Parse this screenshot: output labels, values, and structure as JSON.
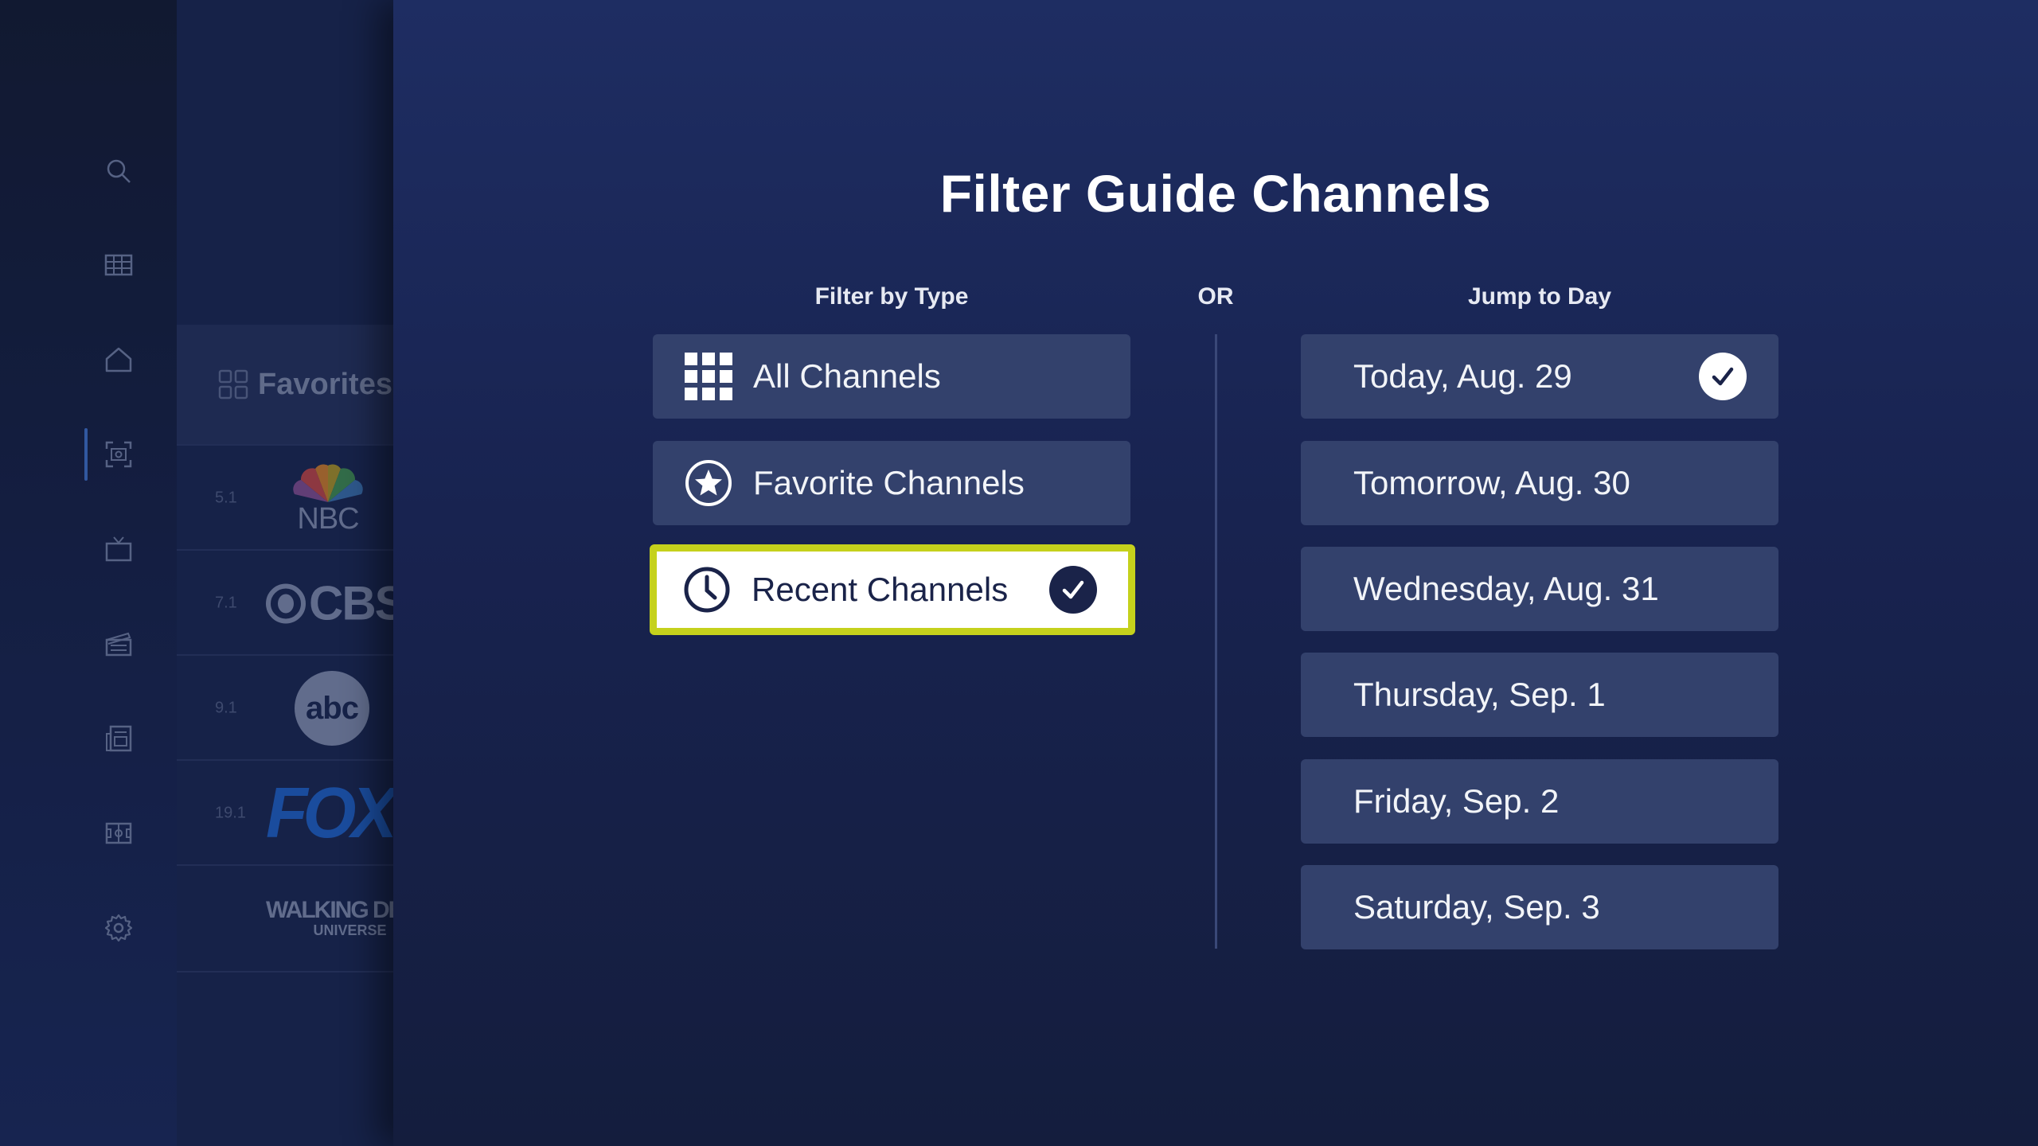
{
  "nav": {
    "icons": [
      "search-icon",
      "guide-grid-icon",
      "home-icon",
      "live-focus-icon",
      "tv-icon",
      "movies-icon",
      "news-icon",
      "sports-icon",
      "settings-icon"
    ],
    "active_index": 3
  },
  "guide": {
    "header_label": "Favorites",
    "channels": [
      {
        "number": "5.1",
        "logo": "NBC"
      },
      {
        "number": "7.1",
        "logo": "CBS"
      },
      {
        "number": "9.1",
        "logo": "abc"
      },
      {
        "number": "19.1",
        "logo": "FOX"
      },
      {
        "number": "",
        "logo": "WALKING DEAD",
        "logo_sub": "UNIVERSE"
      }
    ]
  },
  "modal": {
    "title": "Filter Guide Channels",
    "filter_by_type_heading": "Filter by Type",
    "or_label": "OR",
    "jump_to_day_heading": "Jump to Day",
    "type_options": [
      {
        "label": "All Channels",
        "icon": "grid-icon",
        "selected": false
      },
      {
        "label": "Favorite Channels",
        "icon": "star-circle-icon",
        "selected": false
      },
      {
        "label": "Recent Channels",
        "icon": "clock-icon",
        "selected": true,
        "focused": true
      }
    ],
    "day_options": [
      {
        "label": "Today, Aug. 29",
        "selected": true
      },
      {
        "label": "Tomorrow, Aug. 30",
        "selected": false
      },
      {
        "label": "Wednesday, Aug. 31",
        "selected": false
      },
      {
        "label": "Thursday, Sep. 1",
        "selected": false
      },
      {
        "label": "Friday, Sep. 2",
        "selected": false
      },
      {
        "label": "Saturday, Sep. 3",
        "selected": false
      }
    ],
    "colors": {
      "focus_border": "#c5d11c",
      "option_bg": "#33416c",
      "check_dark": "#1a2349"
    }
  }
}
